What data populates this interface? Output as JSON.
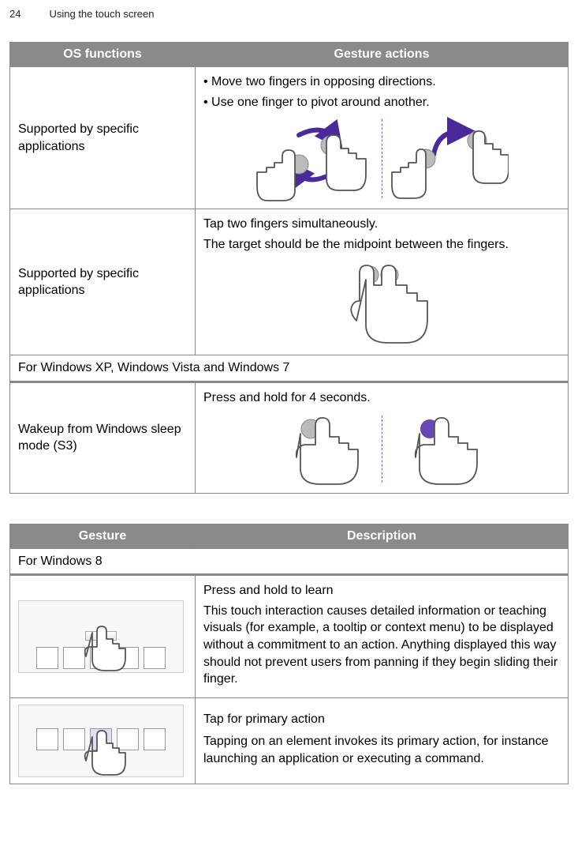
{
  "page": {
    "number": "24",
    "section": "Using the touch screen"
  },
  "table1": {
    "header": {
      "col1": "OS functions",
      "col2": "Gesture actions"
    },
    "rows": [
      {
        "left": "Supported by specific applications",
        "right_lines": [
          "• Move two fingers in opposing directions.",
          "• Use one finger to pivot around another."
        ]
      },
      {
        "left": "Supported by specific applications",
        "right_lines": [
          "Tap two fingers simultaneously.",
          "The target should be the midpoint between the fingers."
        ]
      }
    ],
    "subheader1": "For Windows XP, Windows Vista and Windows 7",
    "row3": {
      "left": "Wakeup from Windows sleep mode (S3)",
      "right_lines": [
        "Press and hold for 4 seconds."
      ]
    }
  },
  "table2": {
    "header": {
      "col1": "Gesture",
      "col2": "Description"
    },
    "subheader": "For Windows 8",
    "rows": [
      {
        "title": "Press and hold to learn",
        "body": "This touch interaction causes detailed information or teaching visuals (for example, a tooltip or context menu) to be displayed without a commitment to an action. Anything displayed this way should not prevent users from panning if they begin sliding their finger."
      },
      {
        "title": "Tap for primary action",
        "body": "Tapping on an element invokes its primary action, for instance launching an application or executing a command."
      }
    ]
  }
}
